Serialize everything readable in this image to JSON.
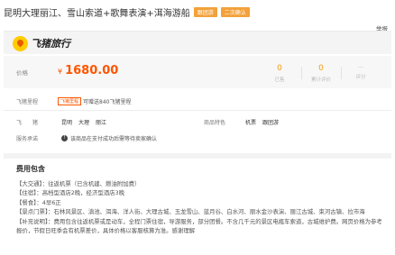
{
  "product": {
    "title": "昆明大理丽江、雪山索道+歌舞表演+洱海游船",
    "badges": [
      "跟团游",
      "二次确认"
    ],
    "report_link": "举报"
  },
  "brand": {
    "name": "飞猪旅行",
    "icon": "fliggy-logo-icon",
    "accent": "#ffcc00"
  },
  "price": {
    "label": "价格",
    "currency": "¥",
    "amount": "1680.00",
    "color": "#ff5500"
  },
  "stats": [
    {
      "value": "0",
      "label": "已售"
    },
    {
      "value": "0",
      "label": "累计评价"
    },
    {
      "value": "--",
      "label": "评分",
      "prefix": "—"
    }
  ],
  "points": {
    "label": "飞猪里程",
    "tag": "飞猪里程",
    "text": "可赠送840飞猪里程"
  },
  "departure": {
    "label": "飞　　猪",
    "cities": [
      "昆明",
      "大理",
      "丽江"
    ]
  },
  "product_tags": {
    "label": "商品特色",
    "items": [
      "机票",
      "跟团游"
    ]
  },
  "service": {
    "label": "服务承诺",
    "text": "该商品在支付成功后需等待卖家确认",
    "icon": "info-circle-icon"
  },
  "fee_section": {
    "title": "费用包含",
    "lines": [
      "【大交通】：往返机票（已含机建、燃油附加费）",
      "【住宿】：高档型酒店2晚，经济型酒店3晚",
      "【餐食】：4早6正",
      "【景点门票】：石林风景区、滇池、洱海、洋人街、大理古城、玉龙雪山、蓝月谷、白水河、丽水金沙表演、丽江古城、束河古镇、拉市海",
      "【补充说明】：费用包含往返机票或是动车，全程门票住宿，导游服务，部分团餐。不含几千元的景区电瓶车索道，古城维护费。网页价格为参考报价，节假日旺季会有机票差价，具体价格以客服核算为准。感谢理解"
    ]
  }
}
